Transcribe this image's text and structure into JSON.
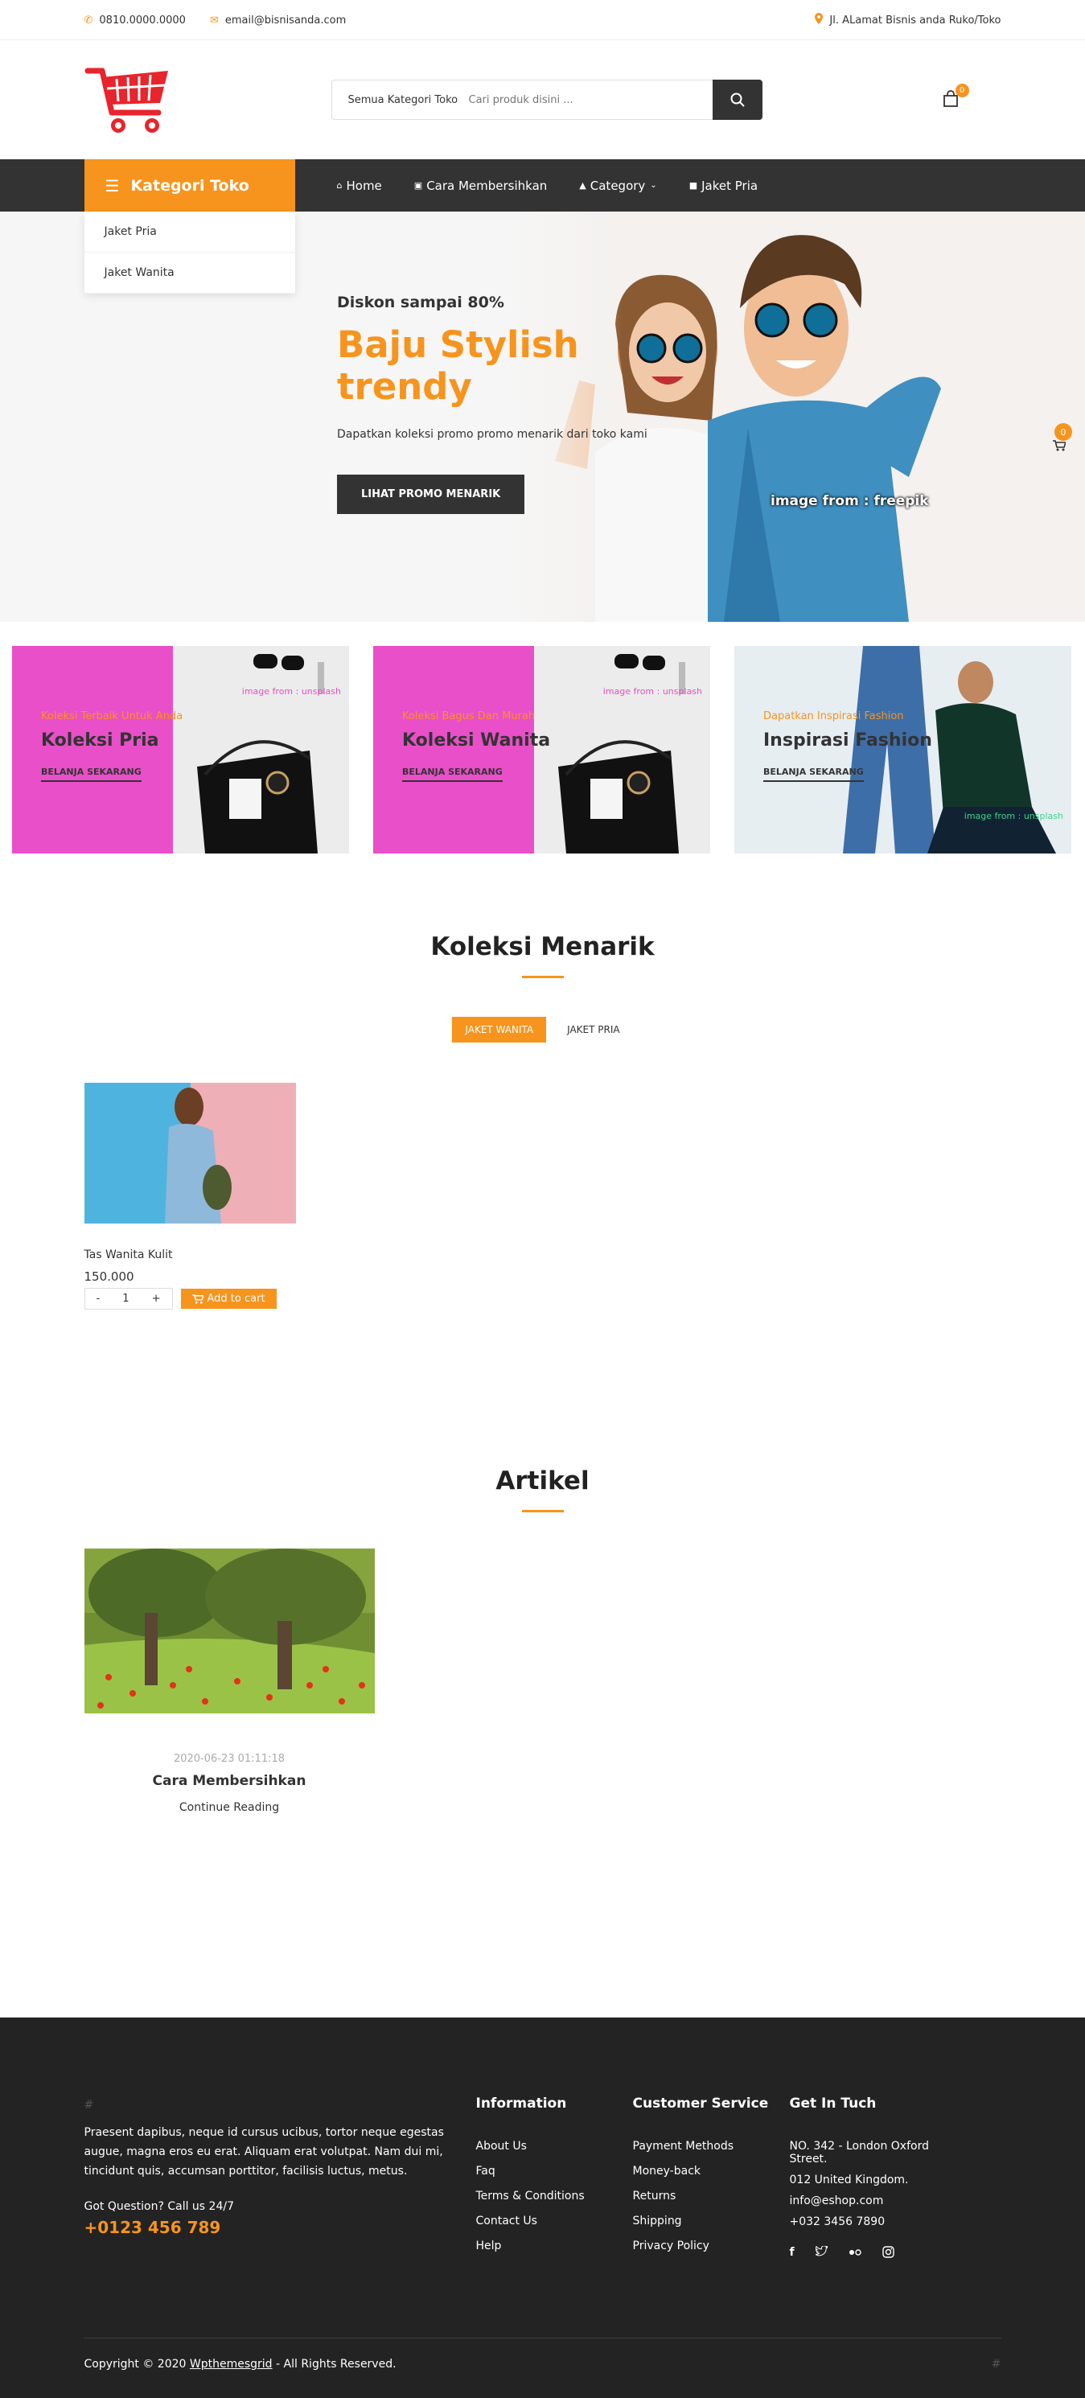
{
  "topbar": {
    "phone": "0810.0000.0000",
    "email": "email@bisnisanda.com",
    "address": "Jl. ALamat Bisnis anda Ruko/Toko"
  },
  "header": {
    "search_category": "Semua Kategori Toko",
    "search_placeholder": "Cari produk disini ...",
    "cart_count": "0"
  },
  "nav": {
    "category_label": "Kategori Toko",
    "menu": [
      {
        "icon": "home-icon",
        "label": "Home"
      },
      {
        "icon": "card-icon",
        "label": "Cara Membersihkan"
      },
      {
        "icon": "tag-icon",
        "label": "Category"
      },
      {
        "icon": "box-icon",
        "label": "Jaket Pria"
      }
    ],
    "dropdown": [
      "Jaket Pria",
      "Jaket Wanita"
    ]
  },
  "hero": {
    "discount": "Diskon sampai 80%",
    "title_line1": "Baju Stylish",
    "title_line2": "trendy",
    "description": "Dapatkan koleksi promo promo menarik dari toko kami",
    "button": "LIHAT PROMO MENARIK",
    "credit": "image from : freepik",
    "float_cart_count": "0"
  },
  "banners": [
    {
      "subtitle": "Koleksi Terbaik Untuk Anda",
      "title": "Koleksi Pria",
      "link": "BELANJA SEKARANG",
      "credit": "image from : unsplash"
    },
    {
      "subtitle": "Koleksi Bagus Dan Murah",
      "title": "Koleksi Wanita",
      "link": "BELANJA SEKARANG",
      "credit": "image from : unsplash"
    },
    {
      "subtitle": "Dapatkan Inspirasi Fashion",
      "title": "Inspirasi Fashion",
      "link": "BELANJA SEKARANG",
      "credit": "image from : unsplash"
    }
  ],
  "koleksi": {
    "title": "Koleksi Menarik",
    "tabs": [
      "JAKET WANITA",
      "JAKET PRIA"
    ],
    "product": {
      "name": "Tas Wanita Kulit",
      "price": "150.000",
      "qty": "1",
      "minus": "-",
      "plus": "+",
      "add_to_cart": "Add to cart"
    }
  },
  "artikel": {
    "title": "Artikel",
    "post": {
      "date": "2020-06-23 01:11:18",
      "title": "Cara Membersihkan",
      "more": "Continue Reading"
    }
  },
  "footer": {
    "hash": "#",
    "about": "Praesent dapibus, neque id cursus ucibus, tortor neque egestas augue, magna eros eu erat. Aliquam erat volutpat. Nam dui mi, tincidunt quis, accumsan porttitor, facilisis luctus, metus.",
    "question": "Got Question? Call us 24/7",
    "phone": "+0123 456 789",
    "information": {
      "title": "Information",
      "links": [
        "About Us",
        "Faq",
        "Terms & Conditions",
        "Contact Us",
        "Help"
      ]
    },
    "service": {
      "title": "Customer Service",
      "links": [
        "Payment Methods",
        "Money-back",
        "Returns",
        "Shipping",
        "Privacy Policy"
      ]
    },
    "contact": {
      "title": "Get In Tuch",
      "lines": [
        "NO. 342 - London Oxford Street.",
        "012 United Kingdom.",
        "info@eshop.com",
        "+032 3456 7890"
      ]
    },
    "copyright_prefix": "Copyright © 2020 ",
    "copyright_brand": "Wpthemesgrid",
    "copyright_suffix": " - All Rights Reserved.",
    "hash_right": "#"
  },
  "colors": {
    "accent": "#f7941d",
    "dark": "#333333",
    "footer": "#232323",
    "pink": "#e94fc8"
  }
}
